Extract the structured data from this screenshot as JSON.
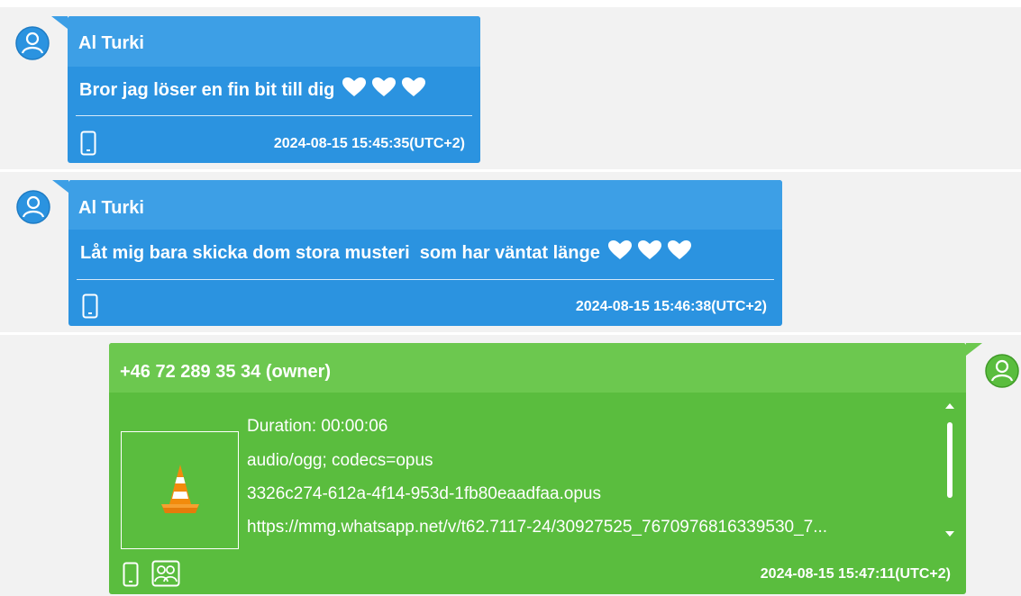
{
  "messages": [
    {
      "sender": "Al Turki",
      "text": "Bror jag löser en fin bit till dig",
      "emoji": "white-heart-icon x3",
      "timestamp": "2024-08-15 15:45:35(UTC+2)",
      "source_icon": "phone-icon",
      "color": "#2b93e0"
    },
    {
      "sender": "Al Turki",
      "text": "Låt mig bara skicka dom stora musteri  som har väntat länge",
      "emoji": "white-heart-icon x3",
      "timestamp": "2024-08-15 15:46:38(UTC+2)",
      "source_icon": "phone-icon",
      "color": "#2b93e0"
    },
    {
      "sender": "+46 72 289 35 34 (owner)",
      "attachment": {
        "thumbnail_icon": "vlc-cone-icon",
        "duration": "Duration: 00:00:06",
        "mime": "audio/ogg; codecs=opus",
        "filename": "3326c274-612a-4f14-953d-1fb80eaadfaa.opus",
        "url": "https://mmg.whatsapp.net/v/t62.7117-24/30927525_7670976816339530_7..."
      },
      "timestamp": "2024-08-15 15:47:11(UTC+2)",
      "source_icon": "phone-icon",
      "extra_icon": "contacts-icon",
      "color": "#5abd3e"
    }
  ]
}
